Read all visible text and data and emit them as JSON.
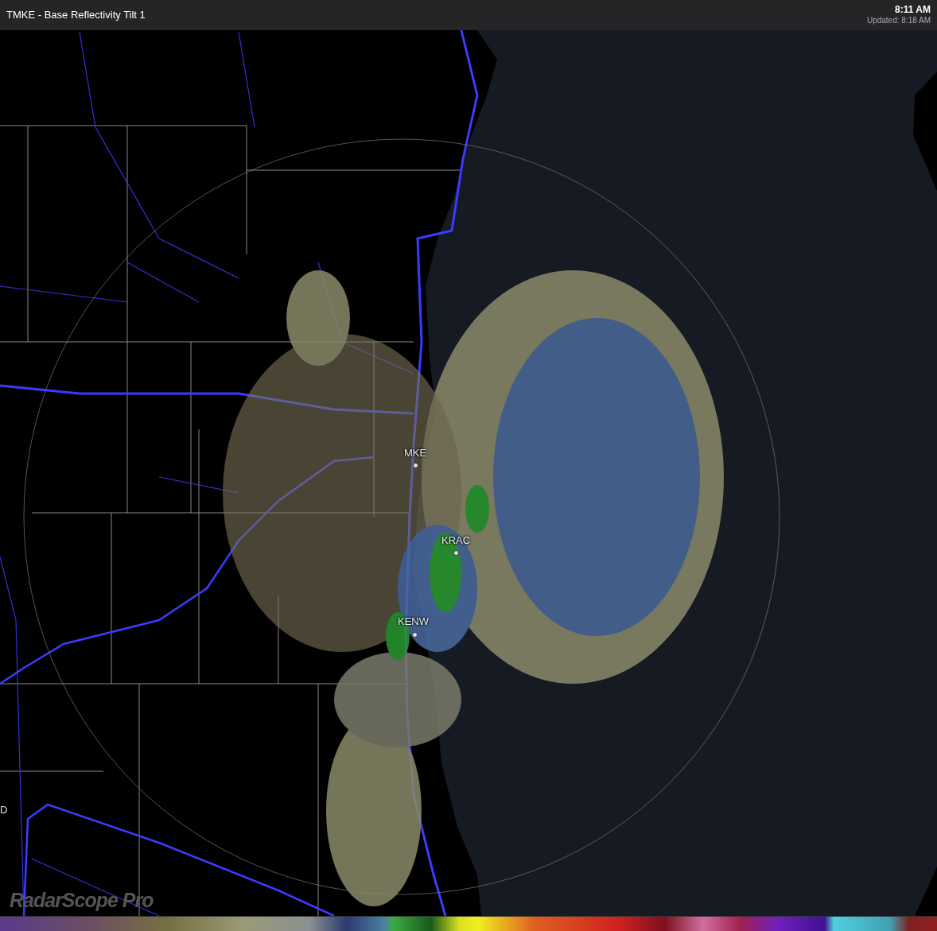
{
  "header": {
    "title": "TMKE - Base Reflectivity Tilt 1",
    "time": "8:11 AM",
    "updated": "Updated: 8:18 AM"
  },
  "stations": [
    {
      "label": "MKE"
    },
    {
      "label": "KRAC"
    },
    {
      "label": "KENW"
    }
  ],
  "edge_label": "D",
  "logo": "RadarScope Pro"
}
